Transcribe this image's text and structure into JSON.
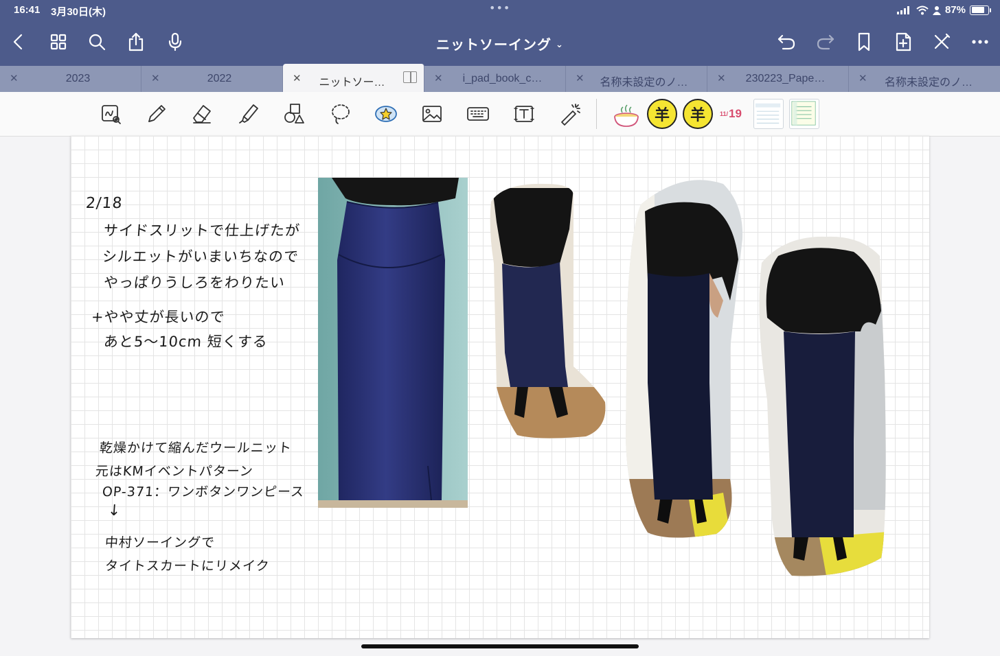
{
  "status": {
    "time": "16:41",
    "date": "3月30日(木)",
    "battery": "87%"
  },
  "nav": {
    "title": "ニットソーイング"
  },
  "tabs": [
    {
      "label": "2023",
      "active": false
    },
    {
      "label": "2022",
      "active": false
    },
    {
      "label": "ニットソー…",
      "active": true
    },
    {
      "label": "i_pad_book_c…",
      "active": false
    },
    {
      "label": "名称未設定のノ…",
      "active": false
    },
    {
      "label": "230223_Pape…",
      "active": false
    },
    {
      "label": "名称未設定のノ…",
      "active": false
    }
  ],
  "toolbar": {
    "stickers": {
      "yen_1": "羊",
      "yen_2": "羊",
      "date_month": "11/",
      "date_day": "19"
    }
  },
  "note": {
    "date": "2/18",
    "lines_top": [
      "サイドスリットで仕上げたが",
      "シルエットがいまいちなので",
      "やっぱりうしろをわりたい",
      "+やや丈が長いので",
      "あと5〜10cm 短くする"
    ],
    "lines_bottom": [
      "乾燥かけて縮んだウールニット",
      "元はKMイベントパターン",
      "OP-371：ワンボタンワンピース",
      "↓",
      "中村ソーイングで",
      "タイトスカートにリメイク"
    ]
  },
  "colors": {
    "navbar": "#4d5b8b",
    "tabbar": "#8d97b5",
    "skirt": "#27306a"
  }
}
